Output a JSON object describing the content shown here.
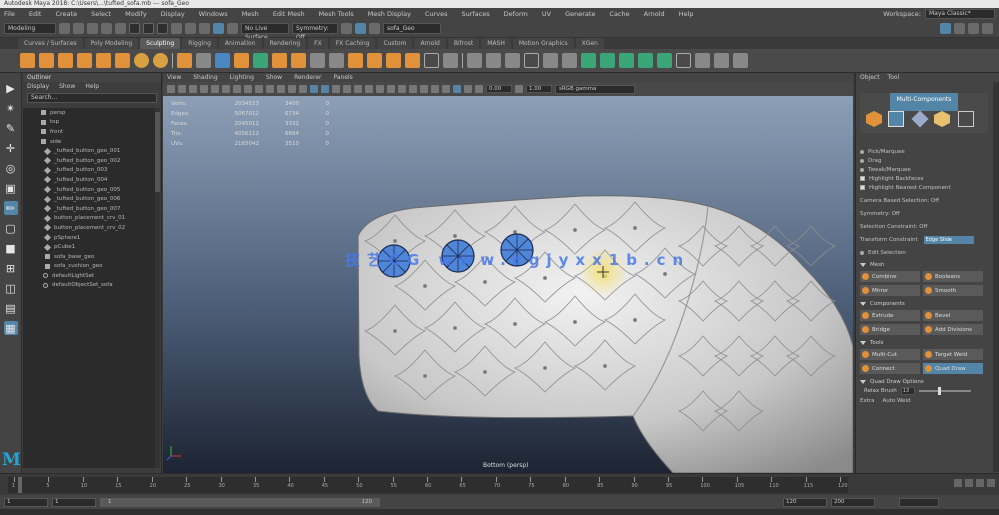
{
  "window": {
    "title": "Autodesk Maya 2018: C:\\Users\\...\\tufted_sofa.mb  ---  sofa_Geo"
  },
  "menus": [
    "File",
    "Edit",
    "Create",
    "Select",
    "Modify",
    "Display",
    "Windows",
    "Mesh",
    "Edit Mesh",
    "Mesh Tools",
    "Mesh Display",
    "Curves",
    "Surfaces",
    "Deform",
    "UV",
    "Generate",
    "Cache",
    "Arnold",
    "Help"
  ],
  "workspace": {
    "label": "Workspace:",
    "value": "Maya Classic*"
  },
  "status_line": {
    "mode": "Modeling",
    "symmetry": "Symmetry: Off",
    "live_surface": "No Live Surface",
    "input_field": "sofa_Geo"
  },
  "shelf_tabs": [
    "Curves / Surfaces",
    "Poly Modeling",
    "Sculpting",
    "Rigging",
    "Animation",
    "Rendering",
    "FX",
    "FX Caching",
    "Custom",
    "Arnold",
    "Bifrost",
    "MASH",
    "Motion Graphics",
    "XGen"
  ],
  "shelf_active_tab": 2,
  "outliner": {
    "title": "Outliner",
    "menus": [
      "Display",
      "Show",
      "Help"
    ],
    "search_placeholder": "Search...",
    "items": [
      {
        "label": "persp",
        "icon": "camera-icon"
      },
      {
        "label": "top",
        "icon": "camera-icon"
      },
      {
        "label": "front",
        "icon": "camera-icon"
      },
      {
        "label": "side",
        "icon": "camera-icon"
      },
      {
        "label": "_tufted_button_geo_001",
        "icon": "mesh-icon"
      },
      {
        "label": "_tufted_button_geo_002",
        "icon": "mesh-icon"
      },
      {
        "label": "_tufted_button_003",
        "icon": "mesh-icon"
      },
      {
        "label": "_tufted_button_004",
        "icon": "mesh-icon"
      },
      {
        "label": "_tufted_button_geo_005",
        "icon": "mesh-icon"
      },
      {
        "label": "_tufted_button_geo_006",
        "icon": "mesh-icon"
      },
      {
        "label": "_tufted_button_geo_007",
        "icon": "mesh-icon"
      },
      {
        "label": "button_placement_crv_01",
        "icon": "mesh-icon"
      },
      {
        "label": "button_placement_crv_02",
        "icon": "mesh-icon"
      },
      {
        "label": "pSphere1",
        "icon": "mesh-icon"
      },
      {
        "label": "pCube1",
        "icon": "mesh-icon"
      },
      {
        "label": "sofa_base_geo",
        "icon": "group-icon"
      },
      {
        "label": "sofa_cushion_geo",
        "icon": "group-icon"
      },
      {
        "label": "defaultLightSet",
        "icon": "set-icon"
      },
      {
        "label": "defaultObjectSet_sofa",
        "icon": "set-icon"
      }
    ]
  },
  "viewport": {
    "menus": [
      "View",
      "Shading",
      "Lighting",
      "Show",
      "Renderer",
      "Panels"
    ],
    "exposure": "0.00",
    "gamma": "1.00",
    "color_space": "sRGB gamma",
    "hud": [
      {
        "label": "Verts:",
        "a": "2034523",
        "b": "3400",
        "c": "0"
      },
      {
        "label": "Edges:",
        "a": "5067012",
        "b": "6734",
        "c": "0"
      },
      {
        "label": "Faces:",
        "a": "2045012",
        "b": "3332",
        "c": "0"
      },
      {
        "label": "Tris:",
        "a": "4056112",
        "b": "6664",
        "c": "0"
      },
      {
        "label": "UVs:",
        "a": "2165042",
        "b": "3510",
        "c": "0"
      }
    ],
    "camera_label": "Bottom (persp)",
    "watermark": "技艺CG www.cgjyxx1b.cn"
  },
  "attribute": {
    "tabs": [
      "Object",
      "Tool"
    ],
    "modeling_toolkit_title": "Multi-Components",
    "selection_rows": [
      {
        "type": "radio",
        "label": "Pick/Marquee"
      },
      {
        "type": "radio",
        "label": "Drag"
      },
      {
        "type": "radio",
        "label": "Tweak/Marquee"
      },
      {
        "type": "check",
        "label": "Highlight Backfaces",
        "on": true
      },
      {
        "type": "check",
        "label": "Highlight Nearest Component",
        "on": true
      }
    ],
    "soft_select": "Camera Based Selection: Off",
    "symmetry": "Symmetry: Off",
    "constraint": "Selection Constraint: Off",
    "transform_constraint": "Transform Constraint",
    "transform_value": "Edge Slide",
    "edit_select": "Edit Selection",
    "sections": [
      {
        "title": "Mesh",
        "buttons": [
          {
            "label": "Combine",
            "sel": false
          },
          {
            "label": "Booleans",
            "sel": false
          },
          {
            "label": "Mirror",
            "sel": false
          },
          {
            "label": "Smooth",
            "sel": false
          }
        ]
      },
      {
        "title": "Components",
        "buttons": [
          {
            "label": "Extrude",
            "sel": false
          },
          {
            "label": "Bevel",
            "sel": false
          },
          {
            "label": "Bridge",
            "sel": false
          },
          {
            "label": "Add Divisions",
            "sel": false
          }
        ]
      },
      {
        "title": "Tools",
        "buttons": [
          {
            "label": "Multi-Cut",
            "sel": false
          },
          {
            "label": "Target Weld",
            "sel": false
          },
          {
            "label": "Connect",
            "sel": false
          },
          {
            "label": "Quad Draw",
            "sel": true
          }
        ]
      }
    ],
    "quad_draw_options": "Quad Draw Options",
    "relax_label": "Relax Brush",
    "relax_value": "13",
    "relax_fraction": 0.38,
    "extra_label": "Extra",
    "extra_value": "Auto Weld"
  },
  "timeline": {
    "ticks": [
      "1",
      "5",
      "10",
      "15",
      "20",
      "25",
      "30",
      "35",
      "40",
      "45",
      "50",
      "55",
      "60",
      "65",
      "70",
      "75",
      "80",
      "85",
      "90",
      "95",
      "100",
      "105",
      "110",
      "115",
      "120"
    ]
  },
  "range": {
    "start": "1",
    "start2": "1",
    "bar_label": "1",
    "end_label": "120",
    "end": "120",
    "end2": "200"
  }
}
